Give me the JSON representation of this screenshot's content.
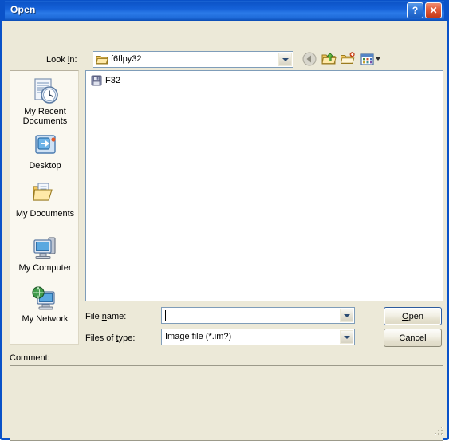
{
  "window": {
    "title": "Open",
    "help_button": "?",
    "close_button": "✕"
  },
  "toolbar": {
    "lookin_label_pre": "Look ",
    "lookin_label_accel": "i",
    "lookin_label_post": "n:",
    "lookin_value": "f6flpy32",
    "back_icon": "back-arrow-icon",
    "up_icon": "up-one-level-icon",
    "newfolder_icon": "create-new-folder-icon",
    "views_icon": "views-menu-icon"
  },
  "places": {
    "items": [
      {
        "label": "My Recent Documents",
        "icon": "recent-documents-icon"
      },
      {
        "label": "Desktop",
        "icon": "desktop-icon"
      },
      {
        "label": "My Documents",
        "icon": "my-documents-icon"
      },
      {
        "label": "My Computer",
        "icon": "my-computer-icon"
      },
      {
        "label": "My Network",
        "icon": "my-network-icon"
      }
    ]
  },
  "filelist": {
    "items": [
      {
        "name": "F32",
        "icon": "file-icon"
      }
    ]
  },
  "form": {
    "filename_label_pre": "File ",
    "filename_label_accel": "n",
    "filename_label_post": "ame:",
    "filename_value": "",
    "filetype_label_pre": "Files of ",
    "filetype_label_accel": "t",
    "filetype_label_post": "ype:",
    "filetype_value": "Image file (*.im?)",
    "open_accel": "O",
    "open_rest": "pen",
    "cancel_label": "Cancel"
  },
  "comment": {
    "label": "Comment:",
    "value": ""
  },
  "colors": {
    "titlebar_blue": "#0c54c8",
    "dialog_face": "#ece9d8",
    "placesbar_face": "#faf8f0",
    "field_border": "#7f9db9",
    "default_button_border": "#2d5c9e",
    "close_red": "#c23a18"
  }
}
